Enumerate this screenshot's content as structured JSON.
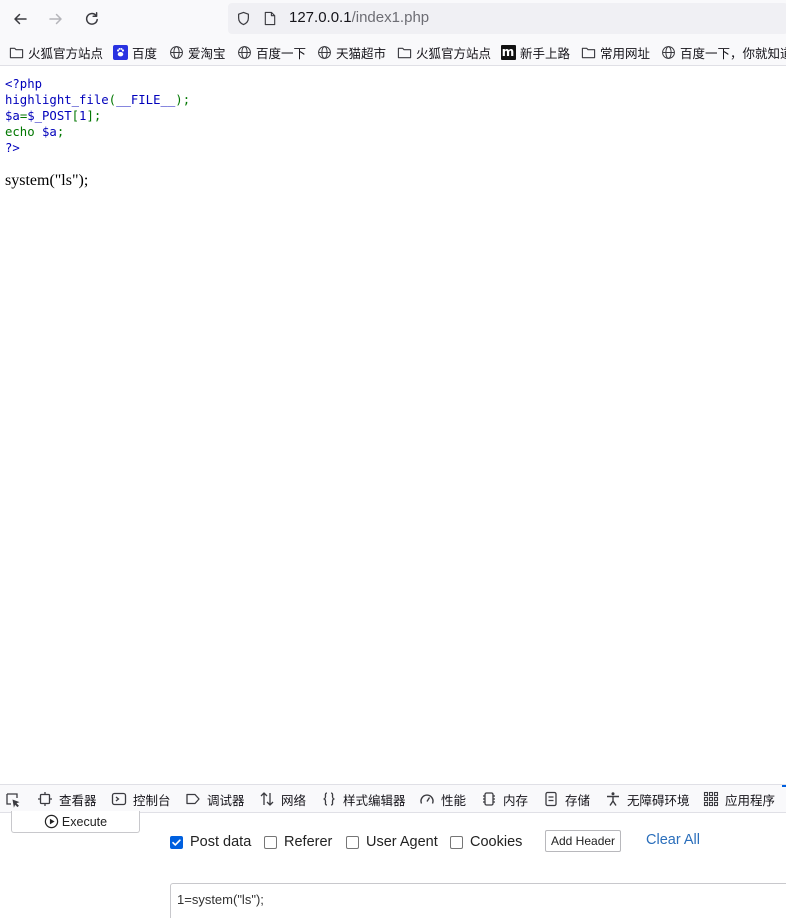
{
  "browser": {
    "url_host": "127.0.0.1",
    "url_path": "/index1.php"
  },
  "bookmarks": [
    {
      "label": "火狐官方站点",
      "icon": "folder-icon"
    },
    {
      "label": "百度",
      "icon": "baidu-paw-icon"
    },
    {
      "label": "爱淘宝",
      "icon": "globe-icon"
    },
    {
      "label": "百度一下",
      "icon": "globe-icon"
    },
    {
      "label": "天猫超市",
      "icon": "globe-icon"
    },
    {
      "label": "火狐官方站点",
      "icon": "folder-icon"
    },
    {
      "label": "新手上路",
      "icon": "m-logo-icon"
    },
    {
      "label": "常用网址",
      "icon": "folder-icon"
    },
    {
      "label": "百度一下，你就知道",
      "icon": "globe-icon"
    }
  ],
  "source": {
    "l1": "<?php",
    "l2a": "highlight_file",
    "l2b": "(",
    "l2c": "__FILE__",
    "l2d": ");",
    "l3a": "$a",
    "l3b": "=",
    "l3c": "$_POST",
    "l3d": "[",
    "l3e": "1",
    "l3f": "];",
    "l4a": "echo ",
    "l4b": "$a",
    "l4c": ";",
    "l5": "?>"
  },
  "output_text": "system(\"ls\");",
  "devtools": {
    "tabs": [
      "查看器",
      "控制台",
      "调试器",
      "网络",
      "样式编辑器",
      "性能",
      "内存",
      "存储",
      "无障碍环境",
      "应用程序"
    ]
  },
  "hackbar": {
    "execute_label": "Execute",
    "post_data_label": "Post data",
    "post_data_checked": true,
    "referer_label": "Referer",
    "user_agent_label": "User Agent",
    "cookies_label": "Cookies",
    "add_header_label": "Add Header",
    "clear_all_label": "Clear All",
    "post_body": "1=system(\"ls\");"
  },
  "colors": {
    "php_default": "#0000BB",
    "php_keyword": "#007700",
    "accent": "#0060df",
    "link": "#2a6ebb"
  }
}
